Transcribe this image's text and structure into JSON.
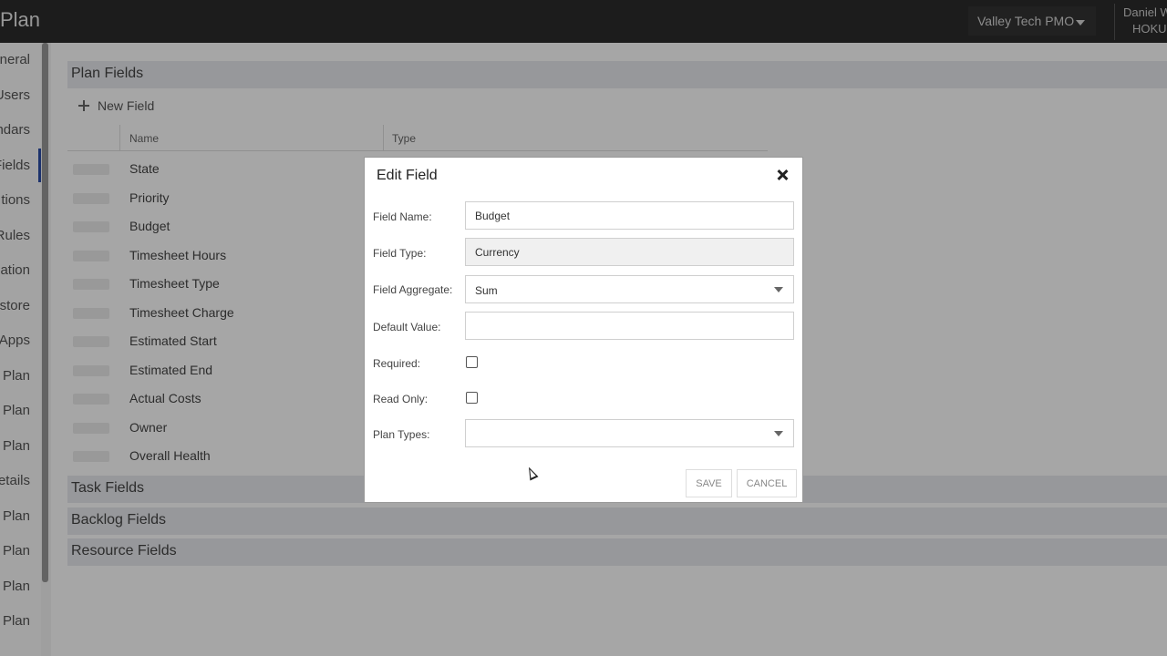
{
  "topbar": {
    "app_title": "Plan",
    "org_name": "Valley Tech PMO",
    "user_name": "Daniel W",
    "user_org": "HOKU"
  },
  "sidebar": {
    "items": [
      {
        "label": "neral"
      },
      {
        "label": "Users"
      },
      {
        "label": "ndars"
      },
      {
        "label": "Fields"
      },
      {
        "label": "tions"
      },
      {
        "label": "Rules"
      },
      {
        "label": "ation"
      },
      {
        "label": "store"
      },
      {
        "label": "Apps"
      },
      {
        "label": "Plan"
      },
      {
        "label": "Plan"
      },
      {
        "label": "Plan"
      },
      {
        "label": "etails"
      },
      {
        "label": "Plan"
      },
      {
        "label": "Plan"
      },
      {
        "label": "Plan"
      },
      {
        "label": "Plan"
      }
    ]
  },
  "main": {
    "plan_fields_title": "Plan Fields",
    "new_field_label": "New Field",
    "columns": {
      "name": "Name",
      "type": "Type"
    },
    "rows": [
      {
        "name": "State"
      },
      {
        "name": "Priority"
      },
      {
        "name": "Budget"
      },
      {
        "name": "Timesheet Hours"
      },
      {
        "name": "Timesheet Type"
      },
      {
        "name": "Timesheet Charge"
      },
      {
        "name": "Estimated Start"
      },
      {
        "name": "Estimated End"
      },
      {
        "name": "Actual Costs"
      },
      {
        "name": "Owner"
      },
      {
        "name": "Overall Health"
      }
    ],
    "task_fields_title": "Task Fields",
    "backlog_fields_title": "Backlog Fields",
    "resource_fields_title": "Resource Fields"
  },
  "modal": {
    "title": "Edit Field",
    "field_name_label": "Field Name:",
    "field_name_value": "Budget",
    "field_type_label": "Field Type:",
    "field_type_value": "Currency",
    "field_aggregate_label": "Field Aggregate:",
    "field_aggregate_value": "Sum",
    "default_value_label": "Default Value:",
    "default_value_value": "",
    "required_label": "Required:",
    "read_only_label": "Read Only:",
    "plan_types_label": "Plan Types:",
    "plan_types_value": "",
    "save_label": "SAVE",
    "cancel_label": "CANCEL"
  }
}
